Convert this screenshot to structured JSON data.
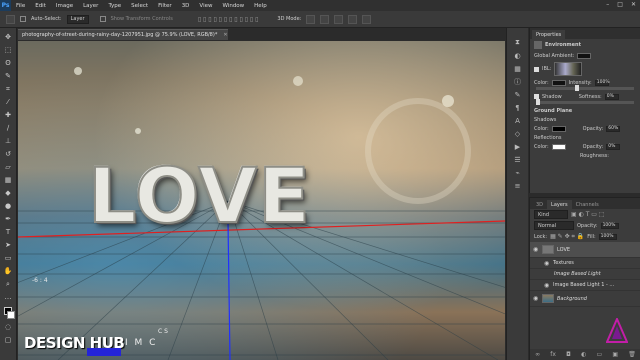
{
  "menu": [
    "File",
    "Edit",
    "Image",
    "Layer",
    "Type",
    "Select",
    "Filter",
    "3D",
    "View",
    "Window",
    "Help"
  ],
  "app_logo": "Ps",
  "options_bar": {
    "auto_select_label": "Auto-Select:",
    "auto_select_value": "Layer",
    "transform_controls": "Show Transform Controls",
    "mode_label": "3D Mode:"
  },
  "document_tab": {
    "title": "photography-of-street-during-rainy-day-1207951.jpg @ 75.9% (LOVE, RGB/8)",
    "modified": "*"
  },
  "canvas": {
    "headline": "LOVE",
    "coords": "-6 : 4",
    "watermark_main": "DESIGN HUB",
    "watermark_letters": "I M C",
    "watermark_small": "C S"
  },
  "properties": {
    "tabs": [
      "Properties"
    ],
    "header": "Environment",
    "global_ambient": "Global Ambient:",
    "ibl_label": "IBL:",
    "color_label": "Color:",
    "intensity_label": "Intensity:",
    "intensity_value": "100%",
    "shadow_label": "Shadow",
    "softness_label": "Softness:",
    "softness_value": "0%",
    "ground_plane": "Ground Plane",
    "shadows_label": "Shadows",
    "opacity_label": "Opacity:",
    "shadow_opacity": "60%",
    "reflections_label": "Reflections",
    "reflect_opacity": "0%",
    "roughness_label": "Roughness:"
  },
  "layers_panel": {
    "tabs": [
      "3D",
      "Layers",
      "Channels"
    ],
    "filter_kind": "Kind",
    "blend_mode": "Normal",
    "opacity_label": "Opacity:",
    "opacity_value": "100%",
    "lock_label": "Lock:",
    "fill_label": "Fill:",
    "fill_value": "100%",
    "layers": [
      {
        "name": "LOVE",
        "type": "3d"
      },
      {
        "name": "Textures",
        "type": "sub"
      },
      {
        "name": "Image Based Light",
        "type": "sub"
      },
      {
        "name": "Image Based Light 1 - ...",
        "type": "sub2"
      },
      {
        "name": "Background",
        "type": "bg"
      }
    ]
  },
  "colors": {
    "accent_blue": "#2424d8",
    "panel": "#3c3c3c",
    "bar": "#303030"
  },
  "icons": [
    "move-icon",
    "marquee-icon",
    "lasso-icon",
    "quick-select-icon",
    "crop-icon",
    "eyedropper-icon",
    "healing-icon",
    "brush-icon",
    "stamp-icon",
    "history-brush-icon",
    "eraser-icon",
    "gradient-icon",
    "blur-icon",
    "dodge-icon",
    "pen-icon",
    "type-icon",
    "path-select-icon",
    "shape-icon",
    "hand-icon",
    "zoom-icon"
  ]
}
